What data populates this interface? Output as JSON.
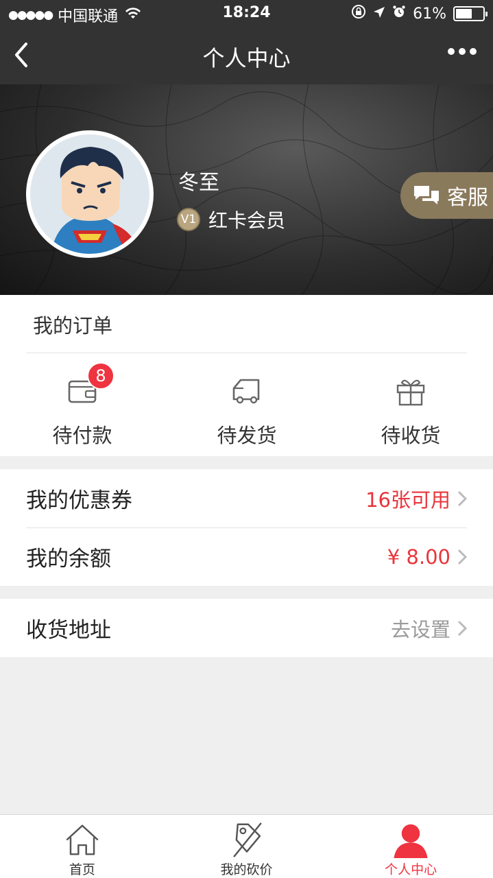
{
  "status_bar": {
    "carrier": "中国联通",
    "time": "18:24",
    "battery": "61%",
    "battery_level": 0.61
  },
  "nav": {
    "title": "个人中心"
  },
  "profile": {
    "username": "冬至",
    "level_badge": "V1",
    "membership": "红卡会员",
    "service_button": "客服"
  },
  "orders": {
    "heading": "我的订单",
    "items": [
      {
        "label": "待付款",
        "icon": "wallet-icon",
        "count": "8"
      },
      {
        "label": "待发货",
        "icon": "truck-icon"
      },
      {
        "label": "待收货",
        "icon": "gift-icon"
      }
    ]
  },
  "account": {
    "coupons_label": "我的优惠券",
    "coupons_value": "16张可用",
    "balance_label": "我的余额",
    "balance_value": "¥ 8.00"
  },
  "address": {
    "label": "收货地址",
    "value": "去设置"
  },
  "tabbar": {
    "items": [
      {
        "label": "首页",
        "icon": "home-icon"
      },
      {
        "label": "我的砍价",
        "icon": "bargain-tag-icon"
      },
      {
        "label": "个人中心",
        "icon": "user-icon",
        "active": true
      }
    ]
  },
  "colors": {
    "accent_red": "#ef3340",
    "topbar": "#333334",
    "service_gold": "#8a7a5c"
  }
}
